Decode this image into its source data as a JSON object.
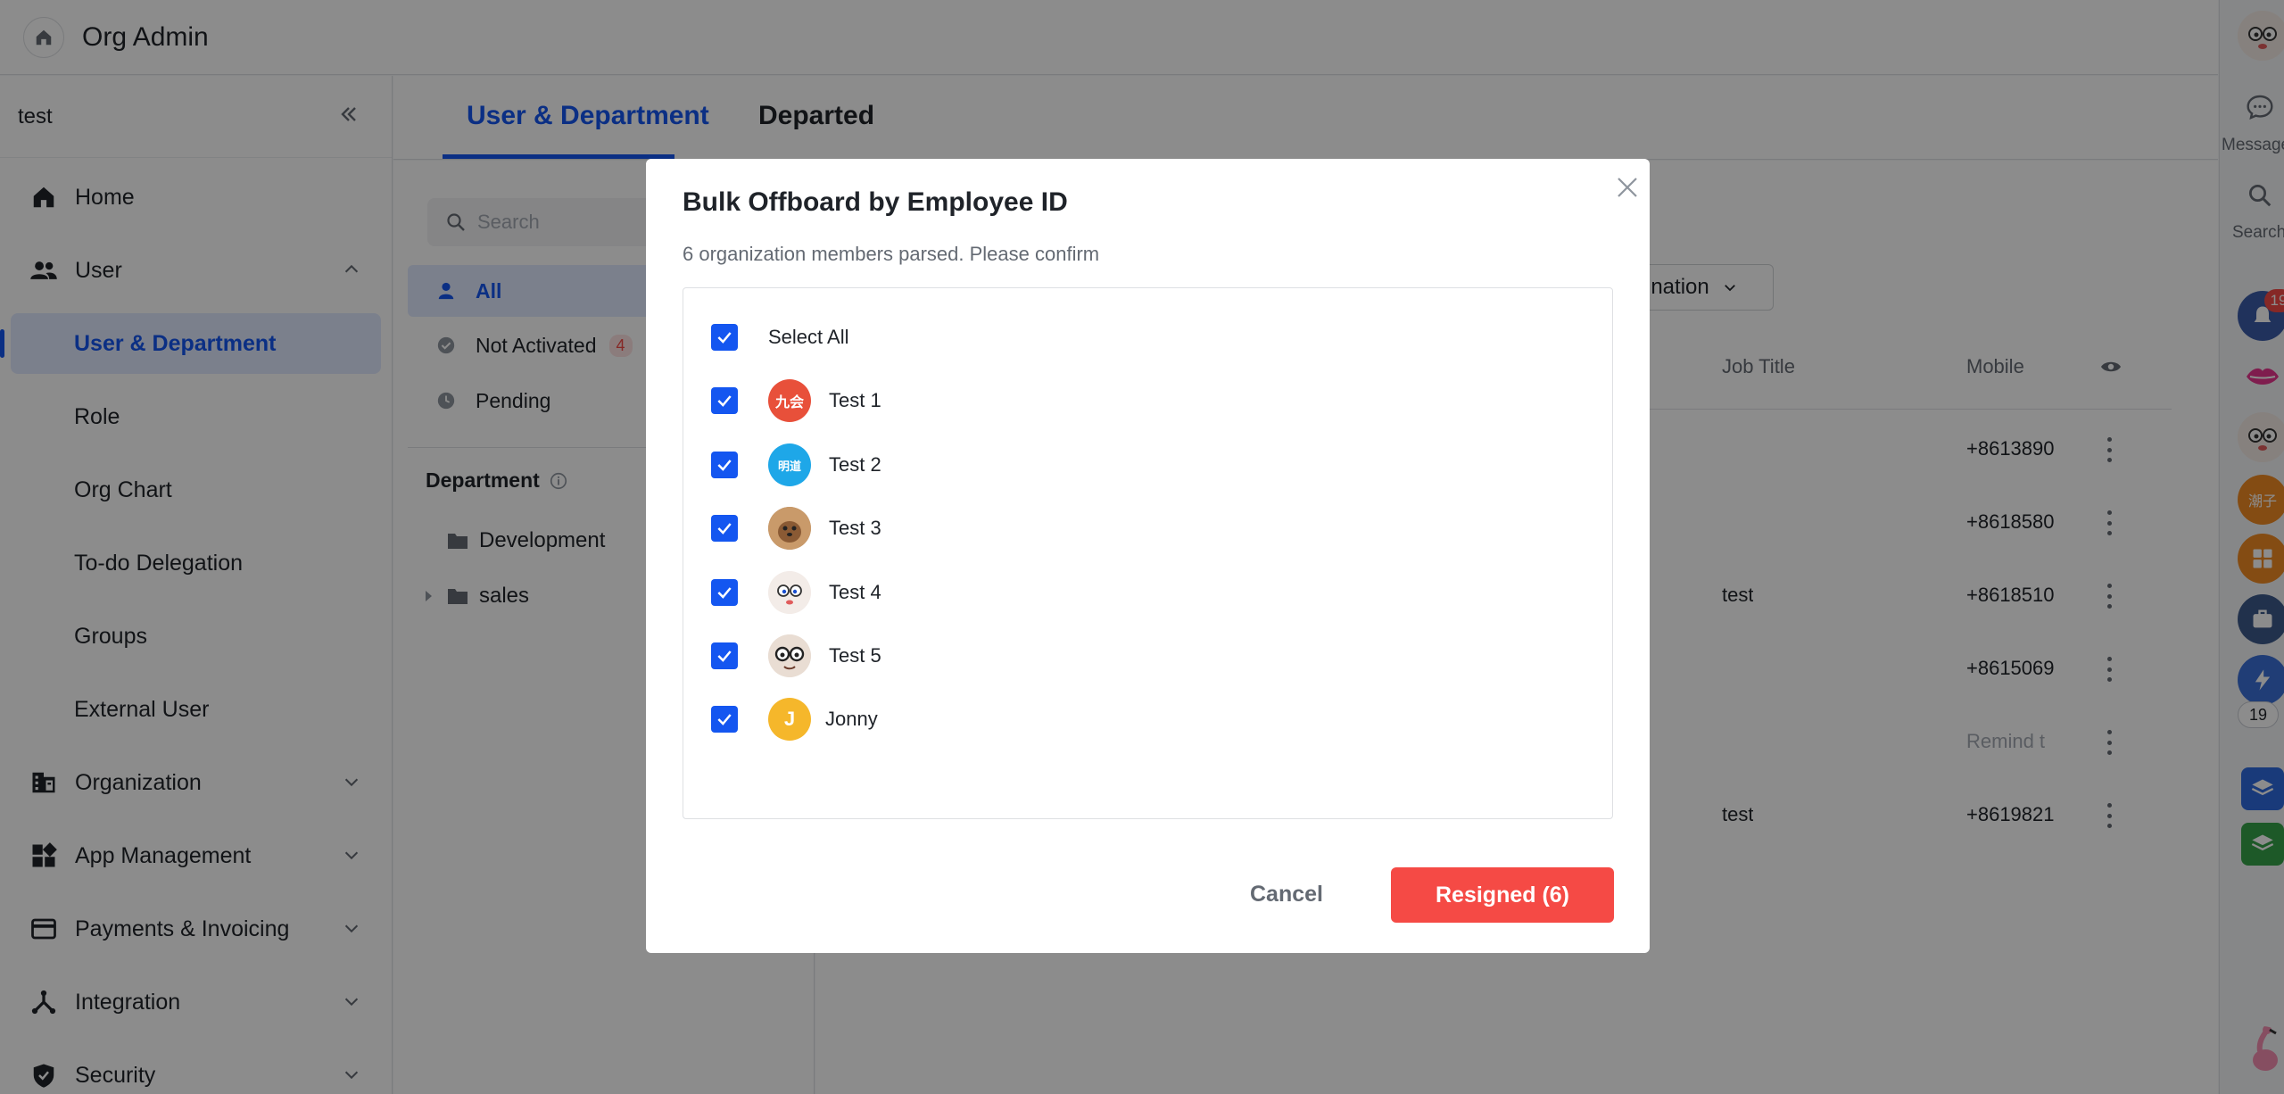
{
  "app": {
    "title": "Org Admin"
  },
  "sidebar": {
    "tenant": "test",
    "items": [
      {
        "label": "Home",
        "icon": "home-icon"
      },
      {
        "label": "User",
        "icon": "users-icon",
        "expanded": true
      },
      {
        "label": "User & Department",
        "sub": true,
        "active": true
      },
      {
        "label": "Role",
        "sub": true
      },
      {
        "label": "Org Chart",
        "sub": true
      },
      {
        "label": "To-do Delegation",
        "sub": true
      },
      {
        "label": "Groups",
        "sub": true
      },
      {
        "label": "External User",
        "sub": true
      },
      {
        "label": "Organization",
        "icon": "building-icon"
      },
      {
        "label": "App Management",
        "icon": "apps-icon"
      },
      {
        "label": "Payments & Invoicing",
        "icon": "card-icon"
      },
      {
        "label": "Integration",
        "icon": "integration-icon"
      },
      {
        "label": "Security",
        "icon": "shield-icon"
      }
    ]
  },
  "tabs": [
    {
      "label": "User & Department",
      "active": true
    },
    {
      "label": "Departed",
      "active": false
    }
  ],
  "filters": {
    "search_placeholder": "Search",
    "items": [
      {
        "label": "All",
        "selected": true
      },
      {
        "label": "Not Activated",
        "count": "4"
      },
      {
        "label": "Pending"
      }
    ],
    "department_title": "Department",
    "departments": [
      "Development",
      "sales"
    ]
  },
  "table": {
    "dropdown_label": "mination",
    "columns": {
      "job_title": "Job Title",
      "mobile": "Mobile"
    },
    "rows": [
      {
        "job_title": "",
        "mobile": "+8613890"
      },
      {
        "job_title": "",
        "mobile": "+8618580"
      },
      {
        "job_title": "test",
        "mobile": "+8618510"
      },
      {
        "job_title": "",
        "mobile": "+8615069"
      },
      {
        "job_title": "",
        "mobile": "Remind t"
      },
      {
        "job_title": "test",
        "mobile": "+8619821"
      }
    ]
  },
  "rail": {
    "messages_label": "Messages",
    "search_label": "Search",
    "notification_badge": "19",
    "count_pill": "19",
    "app_label": "潮子"
  },
  "modal": {
    "title": "Bulk Offboard by Employee ID",
    "subtitle": "6 organization members parsed. Please confirm",
    "select_all": "Select All",
    "members": [
      {
        "name": "Test 1",
        "avatar_text": "九会",
        "avatar_color": "#e8503a"
      },
      {
        "name": "Test 2",
        "avatar_text": "明道",
        "avatar_color": "#1ea7e8"
      },
      {
        "name": "Test 3",
        "avatar_text": "",
        "avatar_color": "#b98a5e"
      },
      {
        "name": "Test 4",
        "avatar_text": "",
        "avatar_color": "#f3ece8"
      },
      {
        "name": "Test 5",
        "avatar_text": "",
        "avatar_color": "#e9ddd3"
      },
      {
        "name": "Jonny",
        "avatar_text": "J",
        "avatar_color": "#f5b72b"
      }
    ],
    "cancel_label": "Cancel",
    "confirm_label": "Resigned (6)"
  },
  "colors": {
    "accent": "#1456f0",
    "danger": "#f54a45"
  }
}
